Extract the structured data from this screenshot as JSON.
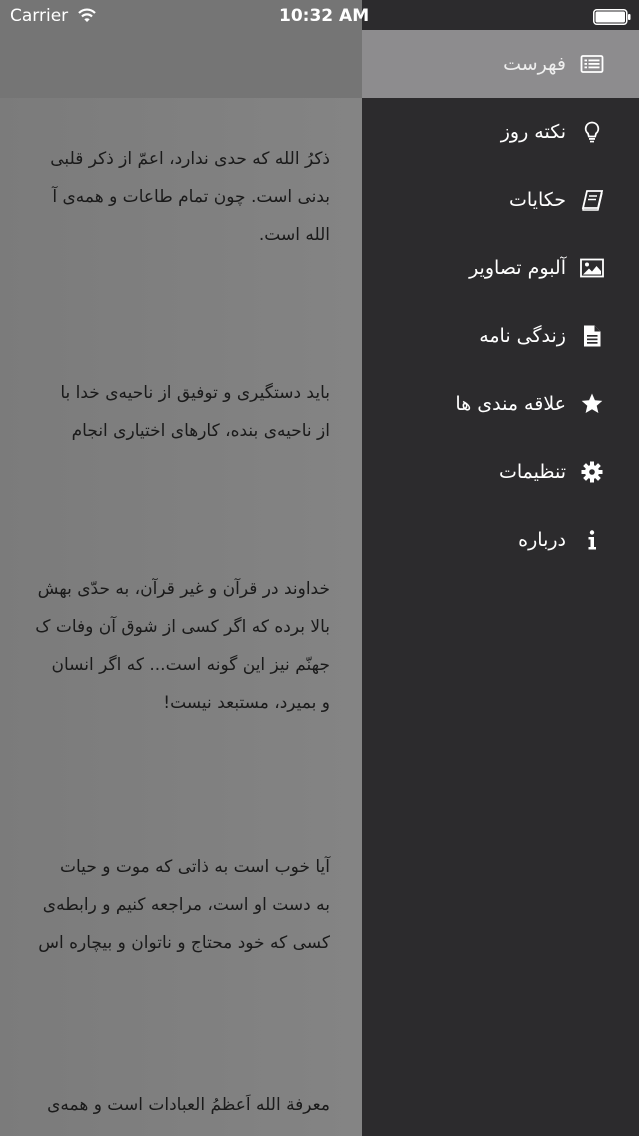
{
  "status_bar": {
    "carrier": "Carrier",
    "time": "10:32 AM"
  },
  "menu": {
    "items": [
      {
        "label": "فهرست",
        "icon": "list-icon",
        "selected": true
      },
      {
        "label": "نکته روز",
        "icon": "lightbulb-icon"
      },
      {
        "label": "حکایات",
        "icon": "book-icon"
      },
      {
        "label": "آلبوم تصاویر",
        "icon": "image-icon"
      },
      {
        "label": "زندگی نامه",
        "icon": "document-icon"
      },
      {
        "label": "علاقه مندی ها",
        "icon": "star-icon"
      },
      {
        "label": "تنظیمات",
        "icon": "gear-icon"
      },
      {
        "label": "درباره",
        "icon": "info-icon"
      }
    ]
  },
  "content": {
    "paragraphs": [
      {
        "lines": [
          "ذکرُ الله که حدی ندارد، اعمّ از ذکر قلبی",
          "بدنی است. چون تمام طاعات و همه‌ی آ",
          "الله است."
        ]
      },
      {
        "lines": [
          "باید دستگیری و توفیق از ناحیه‌ی خدا با",
          "از ناحیه‌ی بنده، کارهای اختیاری انجام"
        ]
      },
      {
        "lines": [
          "خداوند در قرآن و غیر قرآن، به حدّی بهش",
          "بالا برده که اگر کسی از شوق آن وفات ک",
          "جهنّم نیز این گونه است... که اگر انسان",
          "و بمیرد، مستبعد نیست!"
        ]
      },
      {
        "lines": [
          "آیا خوب است به ذاتی که موت و حیات",
          "به دست او است، مراجعه کنیم و رابطه‌ی",
          "کسی که خود محتاج و ناتوان و بیچاره اس"
        ]
      },
      {
        "lines": [
          "معرفة الله اَعظمُ العبادات است و همه‌ی",
          "..."
        ]
      }
    ]
  },
  "colors": {
    "drawer_bg": "#2c2b2d",
    "selected_bg": "#8d8c8e",
    "dim_overlay": "#7a7a7a"
  }
}
